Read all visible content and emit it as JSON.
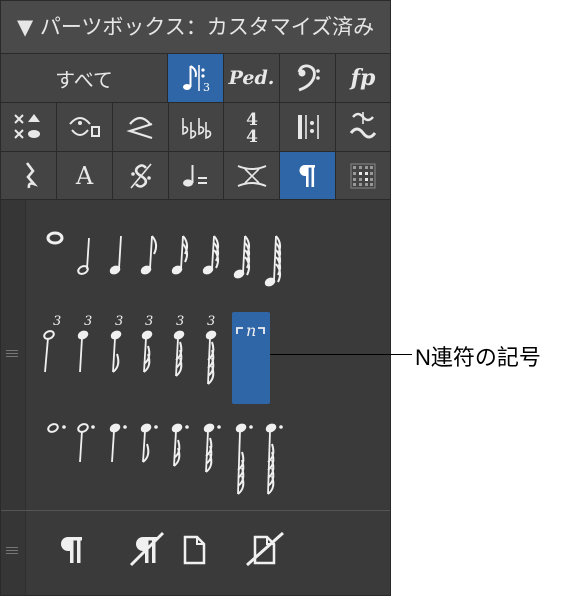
{
  "header": {
    "title": "▼ パーツボックス：カスタマイズ済み"
  },
  "toolbar": {
    "all_label": "すべて",
    "row1_icons": [
      "tuplet-icon",
      "pedal-icon",
      "bass-clef-icon",
      "fp-dynamic-icon"
    ],
    "row1_text": {
      "pedal": "Ped.",
      "fp": "fp"
    },
    "row3_text": {
      "text": "A"
    },
    "selected_icon": "tuplet-icon",
    "time_signature": {
      "top": "4",
      "bottom": "4"
    }
  },
  "notes": {
    "tuplet_number": "3",
    "n_tuplet_label": "n",
    "selected_item": "n-tuplet"
  },
  "callout": {
    "label": "N連符の記号"
  },
  "colors": {
    "panel_bg": "#3a3a3a",
    "header_bg": "#4a4a4a",
    "selected": "#2f66a8",
    "icon": "#e8e8e8"
  }
}
